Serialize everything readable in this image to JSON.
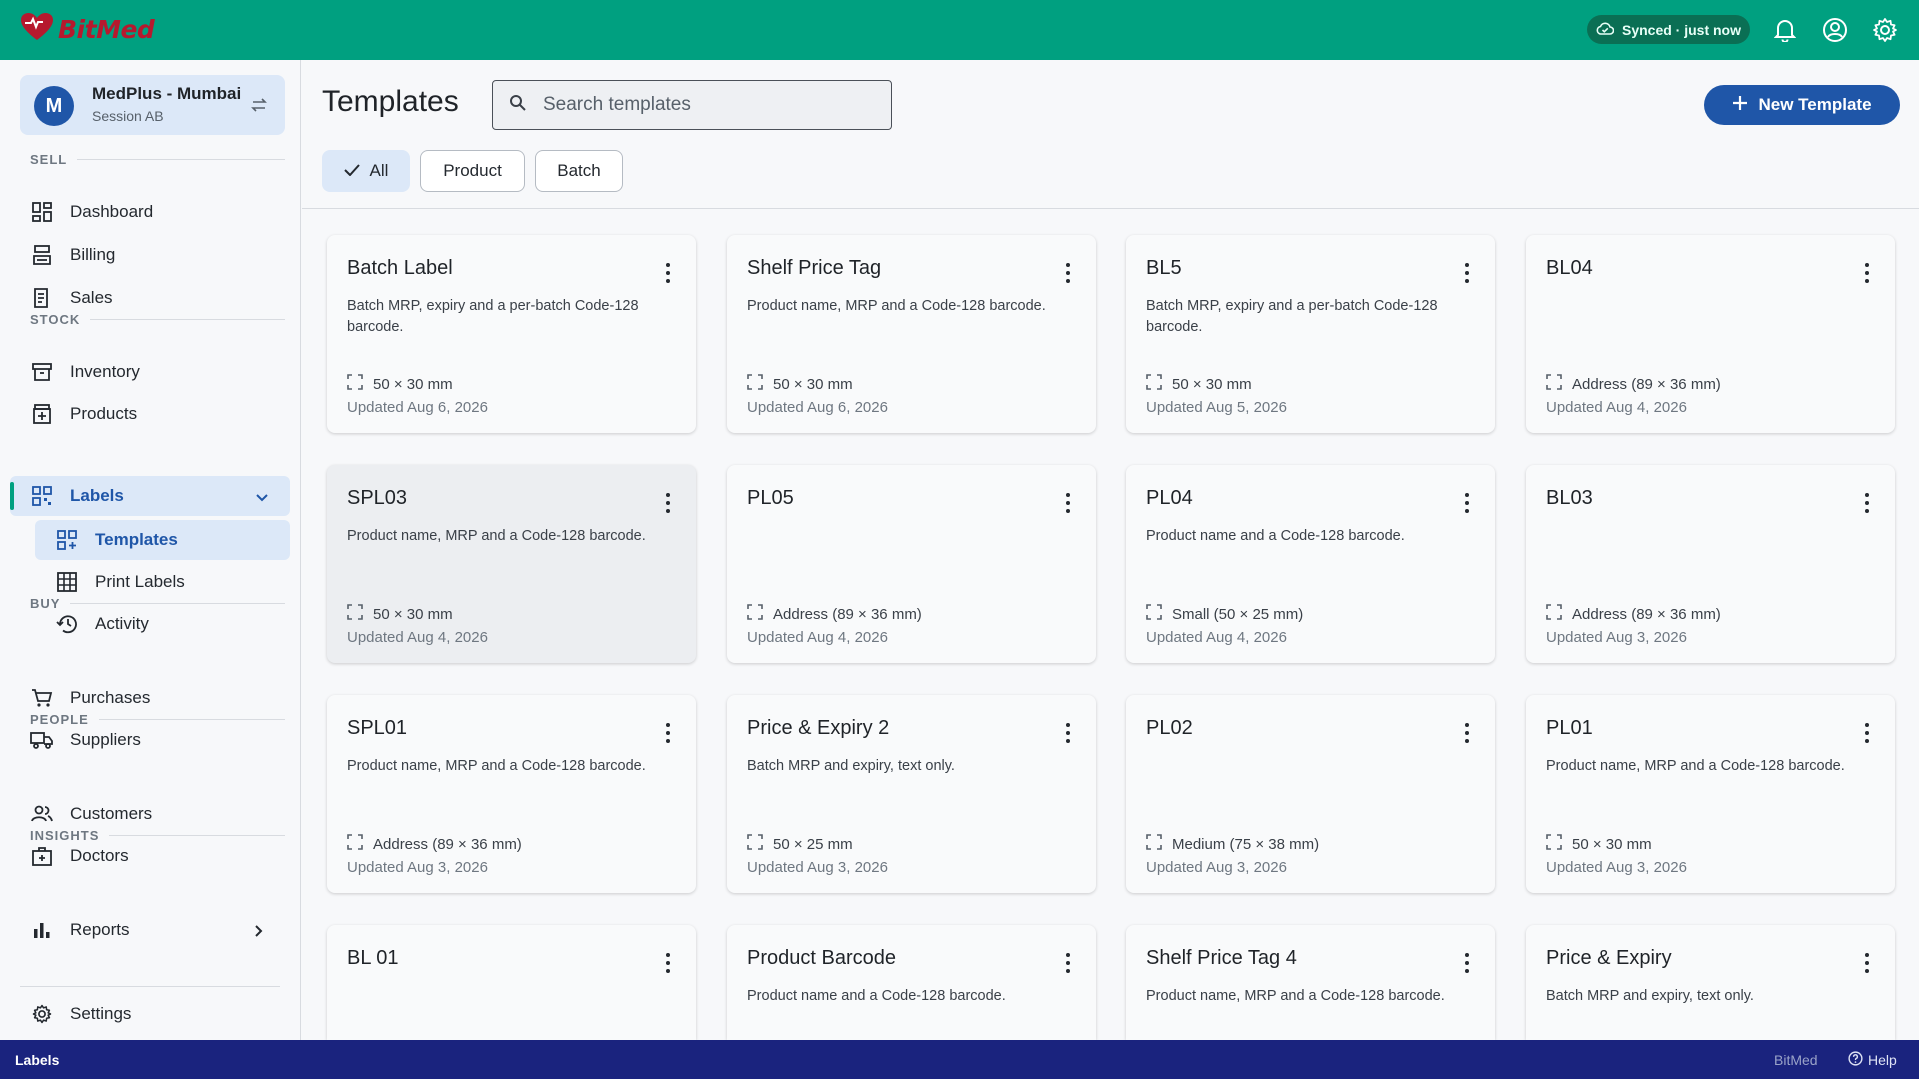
{
  "app": {
    "name": "BitMed",
    "brand_color": "#b6192e",
    "header_color": "#00a080"
  },
  "topbar": {
    "sync_status": "Synced · just now",
    "icons": [
      "cloud-check-icon",
      "bell-icon",
      "account-icon",
      "gear-icon"
    ]
  },
  "org": {
    "avatar_letter": "M",
    "name": "MedPlus - Mumbai",
    "session": "Session AB"
  },
  "sidebar": {
    "sections": {
      "sell": "SELL",
      "stock": "STOCK",
      "buy": "BUY",
      "people": "PEOPLE",
      "insights": "INSIGHTS"
    },
    "items": {
      "dashboard": "Dashboard",
      "billing": "Billing",
      "sales": "Sales",
      "inventory": "Inventory",
      "products": "Products",
      "labels": "Labels",
      "templates": "Templates",
      "print_labels": "Print Labels",
      "activity": "Activity",
      "purchases": "Purchases",
      "suppliers": "Suppliers",
      "customers": "Customers",
      "doctors": "Doctors",
      "reports": "Reports",
      "settings": "Settings"
    }
  },
  "header": {
    "title": "Templates",
    "search_placeholder": "Search templates",
    "new_button": "New Template"
  },
  "filters": {
    "all": "All",
    "product": "Product",
    "batch": "Batch",
    "selected": "All"
  },
  "cards": [
    {
      "title": "Batch Label",
      "desc": "Batch MRP, expiry and a per-batch Code-128 barcode.",
      "size": "50 × 30 mm",
      "updated": "Updated Aug 6, 2026"
    },
    {
      "title": "Shelf Price Tag",
      "desc": "Product name, MRP and a Code-128 barcode.",
      "size": "50 × 30 mm",
      "updated": "Updated Aug 6, 2026"
    },
    {
      "title": "BL5",
      "desc": "Batch MRP, expiry and a per-batch Code-128 barcode.",
      "size": "50 × 30 mm",
      "updated": "Updated Aug 5, 2026"
    },
    {
      "title": "BL04",
      "desc": "",
      "size": "Address (89 × 36 mm)",
      "updated": "Updated Aug 4, 2026"
    },
    {
      "title": "SPL03",
      "desc": "Product name, MRP and a Code-128 barcode.",
      "size": "50 × 30 mm",
      "updated": "Updated Aug 4, 2026"
    },
    {
      "title": "PL05",
      "desc": "",
      "size": "Address (89 × 36 mm)",
      "updated": "Updated Aug 4, 2026"
    },
    {
      "title": "PL04",
      "desc": "Product name and a Code-128 barcode.",
      "size": "Small (50 × 25 mm)",
      "updated": "Updated Aug 4, 2026"
    },
    {
      "title": "BL03",
      "desc": "",
      "size": "Address (89 × 36 mm)",
      "updated": "Updated Aug 3, 2026"
    },
    {
      "title": "SPL01",
      "desc": "Product name, MRP and a Code-128 barcode.",
      "size": "Address (89 × 36 mm)",
      "updated": "Updated Aug 3, 2026"
    },
    {
      "title": "Price & Expiry 2",
      "desc": "Batch MRP and expiry, text only.",
      "size": "50 × 25 mm",
      "updated": "Updated Aug 3, 2026"
    },
    {
      "title": "PL02",
      "desc": "",
      "size": "Medium (75 × 38 mm)",
      "updated": "Updated Aug 3, 2026"
    },
    {
      "title": "PL01",
      "desc": "Product name, MRP and a Code-128 barcode.",
      "size": "50 × 30 mm",
      "updated": "Updated Aug 3, 2026"
    },
    {
      "title": "BL 01",
      "desc": "",
      "size": "",
      "updated": ""
    },
    {
      "title": "Product Barcode",
      "desc": "Product name and a Code-128 barcode.",
      "size": "",
      "updated": ""
    },
    {
      "title": "Shelf Price Tag 4",
      "desc": "Product name, MRP and a Code-128 barcode.",
      "size": "",
      "updated": ""
    },
    {
      "title": "Price & Expiry",
      "desc": "Batch MRP and expiry, text only.",
      "size": "",
      "updated": ""
    }
  ],
  "statusbar": {
    "left": "Labels",
    "brand": "BitMed",
    "help": "Help"
  }
}
